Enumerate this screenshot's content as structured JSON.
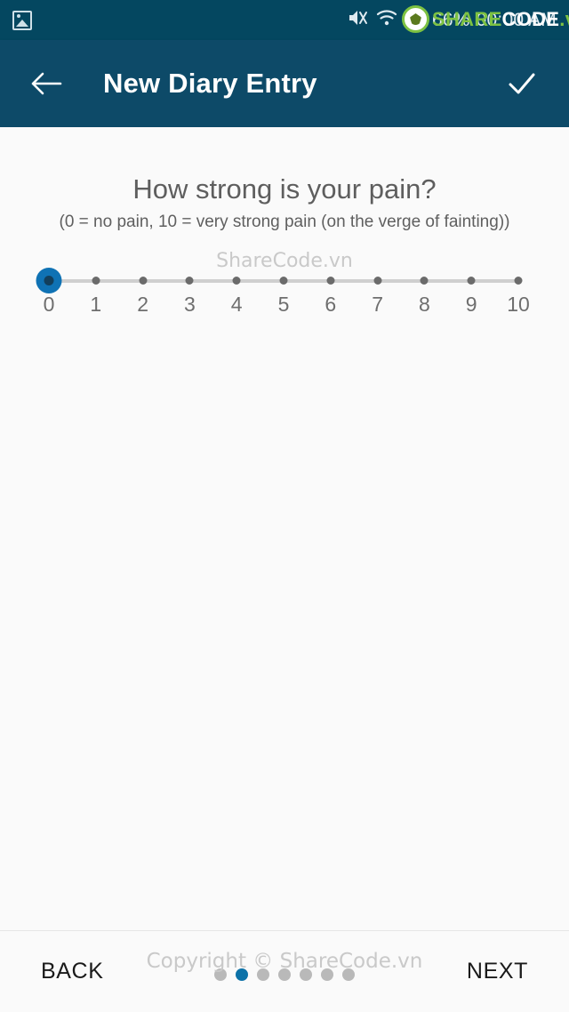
{
  "status_bar": {
    "photo_icon": "photo-icon",
    "mute_icon": "mute-icon",
    "wifi_icon": "wifi-icon",
    "signal_icon": "signal-icon",
    "battery": "66%",
    "time": "00:00 AM",
    "background_color": "#044760"
  },
  "watermark": {
    "logo_share": "SHARE",
    "logo_code": "CODE",
    "logo_vn": ".vn",
    "center": "ShareCode.vn",
    "bottom": "Copyright © ShareCode.vn"
  },
  "app_bar": {
    "back_icon": "arrow-left-icon",
    "title": "New Diary Entry",
    "confirm_icon": "check-icon",
    "background_color": "#0d4a68"
  },
  "main": {
    "question": "How strong is your pain?",
    "hint": "(0 = no pain, 10 = very strong pain (on the verge of fainting))"
  },
  "slider": {
    "min": 0,
    "max": 10,
    "value": 0,
    "ticks": [
      "0",
      "1",
      "2",
      "3",
      "4",
      "5",
      "6",
      "7",
      "8",
      "9",
      "10"
    ],
    "thumb_color": "#0f72b4",
    "track_color": "#cfcfcf"
  },
  "bottom_bar": {
    "back_label": "BACK",
    "next_label": "NEXT",
    "page_count": 7,
    "active_page": 2,
    "active_color": "#0d72a8",
    "inactive_color": "#b9b9b9"
  }
}
